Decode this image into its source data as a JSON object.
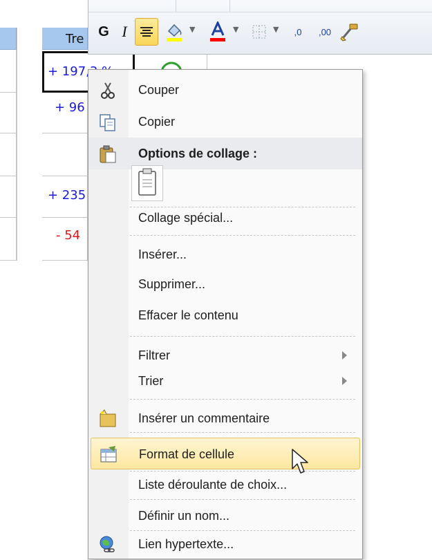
{
  "sheet": {
    "header_partial": "Tre",
    "cells": [
      "+ 197,3 %",
      "+ 96",
      "-",
      "+ 235",
      "- 54"
    ]
  },
  "mini_toolbar": {
    "bold_label": "G",
    "italic_label": "I",
    "decimal_increase_label": ",0",
    "decimal_decrease_label": ",00",
    "icons": [
      "bold-icon",
      "italic-icon",
      "align-center-icon",
      "fill-color-icon",
      "font-color-icon",
      "borders-icon",
      "increase-decimal-icon",
      "decrease-decimal-icon",
      "format-painter-icon"
    ],
    "colors": {
      "fill": "#ffff00",
      "font": "#ff0000",
      "active_bg": "#fbe07a"
    }
  },
  "context_menu": {
    "cut": "Couper",
    "copy": "Copier",
    "paste_options_header": "Options de collage :",
    "paste_special": "Collage spécial...",
    "insert": "Insérer...",
    "delete": "Supprimer...",
    "clear_contents": "Effacer le contenu",
    "filter": "Filtrer",
    "sort": "Trier",
    "insert_comment": "Insérer un commentaire",
    "format_cells": "Format de cellule",
    "dropdown_list": "Liste déroulante de choix...",
    "define_name": "Définir un nom...",
    "hyperlink": "Lien hypertexte..."
  },
  "colors": {
    "hover_bg": "#fde7a0",
    "header_cell": "#a6c8ee"
  }
}
